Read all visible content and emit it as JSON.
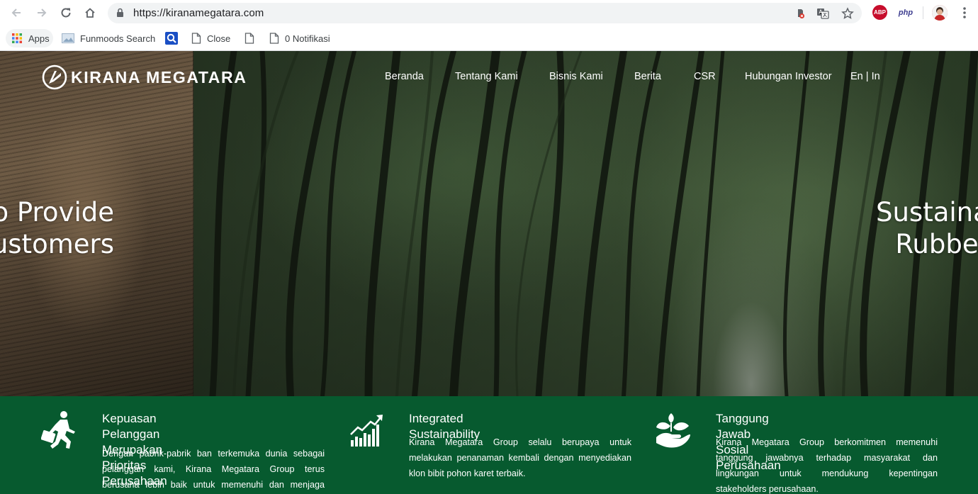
{
  "browser": {
    "url": "https://kiranamegatara.com",
    "extensions": {
      "abp_label": "ABP",
      "php_label": "php"
    },
    "bookmarks": [
      {
        "label": "Apps",
        "icon": "apps-grid-icon"
      },
      {
        "label": "Funmoods Search",
        "icon": "funmoods-icon"
      },
      {
        "label": "",
        "icon": "search-q-icon"
      },
      {
        "label": "Close",
        "icon": "page-icon"
      },
      {
        "label": "",
        "icon": "page-icon"
      },
      {
        "label": "0 Notifikasi",
        "icon": "page-icon"
      }
    ]
  },
  "site": {
    "logo_text": "KIRANA MEGATARA",
    "nav": [
      {
        "label": "Beranda"
      },
      {
        "label": "Tentang Kami"
      },
      {
        "label": "Bisnis Kami"
      },
      {
        "label": "Berita"
      },
      {
        "label": "CSR"
      },
      {
        "label": "Hubungan Investor"
      }
    ],
    "lang": {
      "en": "En",
      "sep": "|",
      "in": "In"
    },
    "hero": {
      "left_line1": "to Provide",
      "left_line2": "ustomers",
      "right_line1": "Sustaina",
      "right_line2": "Rubber"
    },
    "features": [
      {
        "icon": "running-man-briefcase-icon",
        "title_line1": "Kepuasan Pelanggan Merupakan Prioritas",
        "title_line2": "Perusahaan",
        "body_lines": [
          "Dengan pabrik-pabrik ban terkemuka dunia sebagai",
          "pelanggan kami, Kirana Megatara Group terus",
          "berusaha lebih baik untuk memenuhi dan menjaga"
        ]
      },
      {
        "icon": "growth-chart-icon",
        "title_line1": "Integrated Sustainability",
        "body_lines": [
          "Kirana Megatara Group selalu berupaya untuk",
          "melakukan penanaman kembali dengan menyediakan",
          "klon bibit pohon karet terbaik."
        ]
      },
      {
        "icon": "hand-leaf-icon",
        "title_line1": "Tanggung Jawab Sosial Perusahaan",
        "body_lines": [
          "Kirana Megatara Group berkomitmen memenuhi",
          "tanggung jawabnya terhadap masyarakat dan",
          "lingkungan untuk mendukung kepentingan",
          "stakeholders perusahaan."
        ]
      }
    ]
  }
}
